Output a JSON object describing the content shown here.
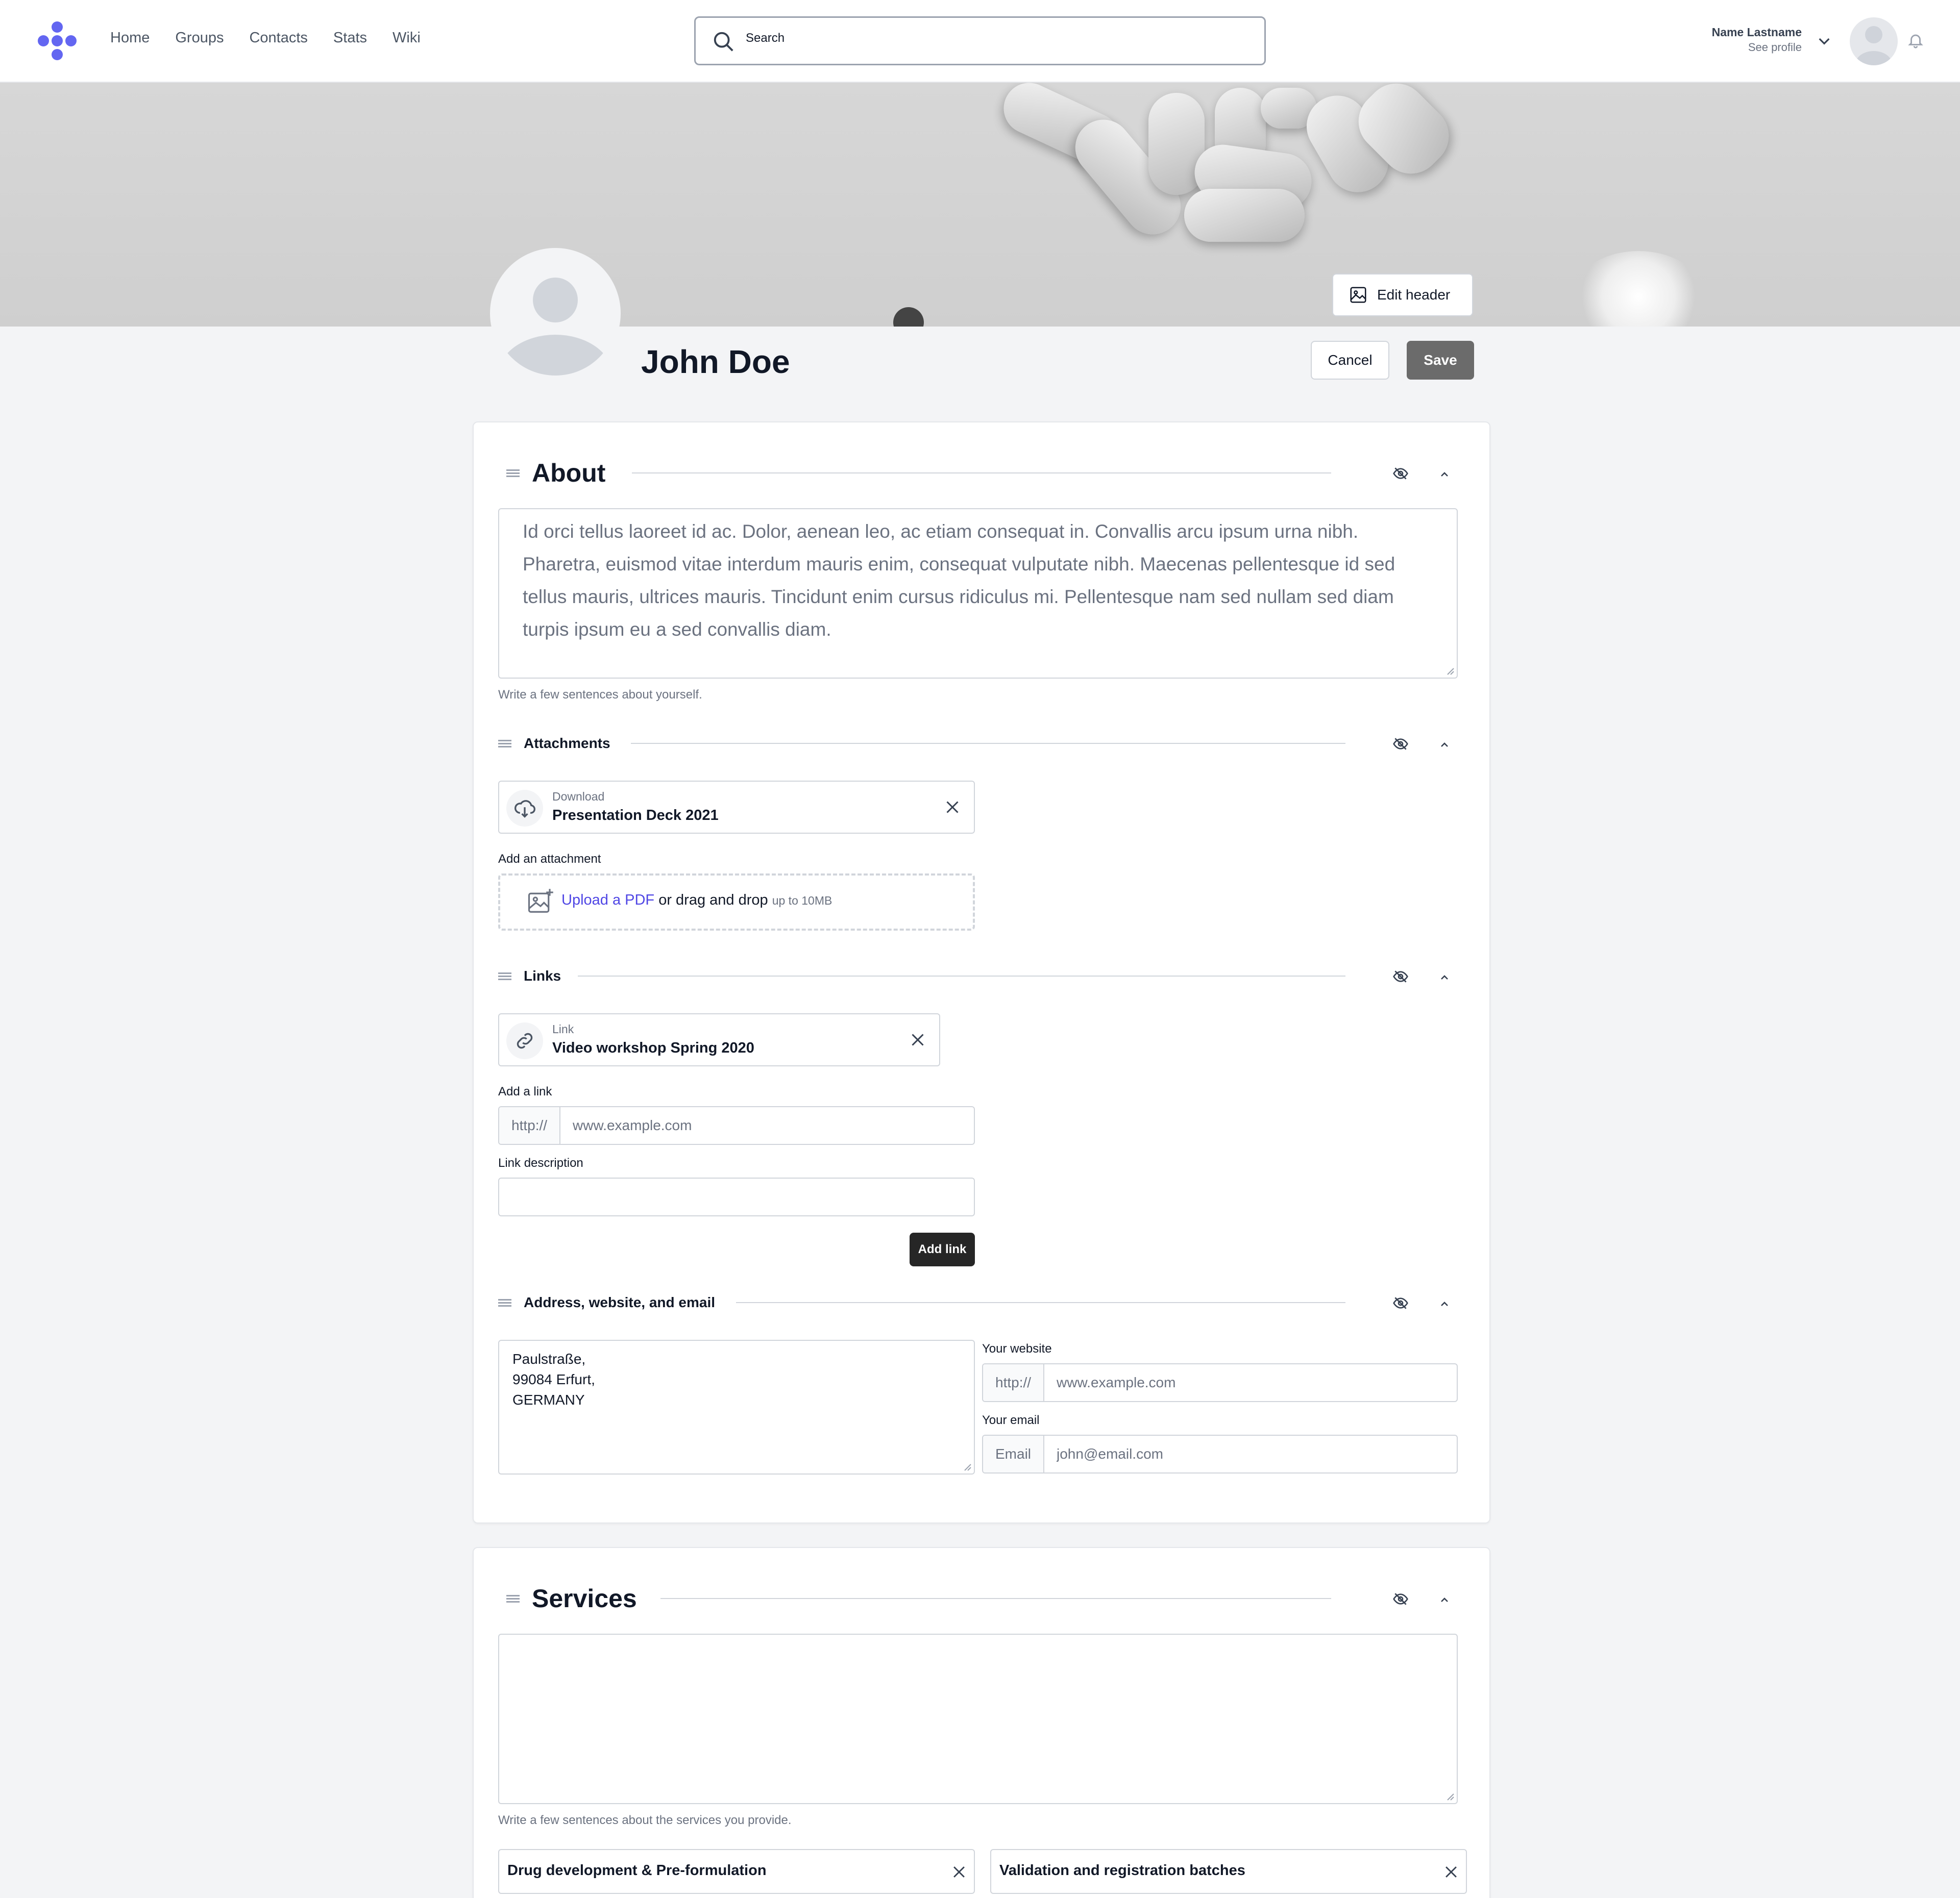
{
  "nav": {
    "items": [
      "Home",
      "Groups",
      "Contacts",
      "Stats",
      "Wiki"
    ]
  },
  "search": {
    "placeholder": "Search"
  },
  "user": {
    "name": "Name Lastname",
    "sub": "See profile"
  },
  "header": {
    "edit_label": "Edit header"
  },
  "profile": {
    "name": "John Doe",
    "cancel": "Cancel",
    "save": "Save"
  },
  "about": {
    "title": "About",
    "text": "Id orci tellus laoreet id ac. Dolor, aenean leo, ac etiam consequat in. Convallis arcu ipsum urna nibh. Pharetra, euismod vitae interdum mauris enim, consequat vulputate nibh. Maecenas pellentesque id sed tellus mauris, ultrices mauris. Tincidunt enim cursus ridiculus mi. Pellentesque nam sed nullam sed diam turpis ipsum eu a sed convallis diam.",
    "help": "Write a few sentences about yourself."
  },
  "attachments": {
    "title": "Attachments",
    "file": {
      "kind": "Download",
      "name": "Presentation Deck 2021"
    },
    "add_label": "Add an attachment",
    "upload_link": "Upload a PDF",
    "upload_rest": " or drag and drop ",
    "upload_limit": "up to 10MB"
  },
  "links": {
    "title": "Links",
    "item": {
      "kind": "Link",
      "name": "Video workshop Spring 2020"
    },
    "add_label": "Add a link",
    "prefix": "http://",
    "url_placeholder": "www.example.com",
    "desc_label": "Link description",
    "add_button": "Add link"
  },
  "contact": {
    "title": "Address, website, and email",
    "address": "Paulstraße,\n99084 Erfurt,\nGERMANY",
    "website_label": "Your website",
    "website_prefix": "http://",
    "website_placeholder": "www.example.com",
    "email_label": "Your email",
    "email_prefix": "Email",
    "email_placeholder": "john@email.com"
  },
  "services": {
    "title": "Services",
    "help": "Write a few sentences about the services you provide.",
    "tags": [
      "Drug development & Pre-formulation",
      "Validation and registration batches"
    ]
  },
  "colors": {
    "accent": "#6366f1",
    "link": "#4f46e5",
    "save_bg": "#6b6b6b",
    "add_link_bg": "#262626"
  }
}
